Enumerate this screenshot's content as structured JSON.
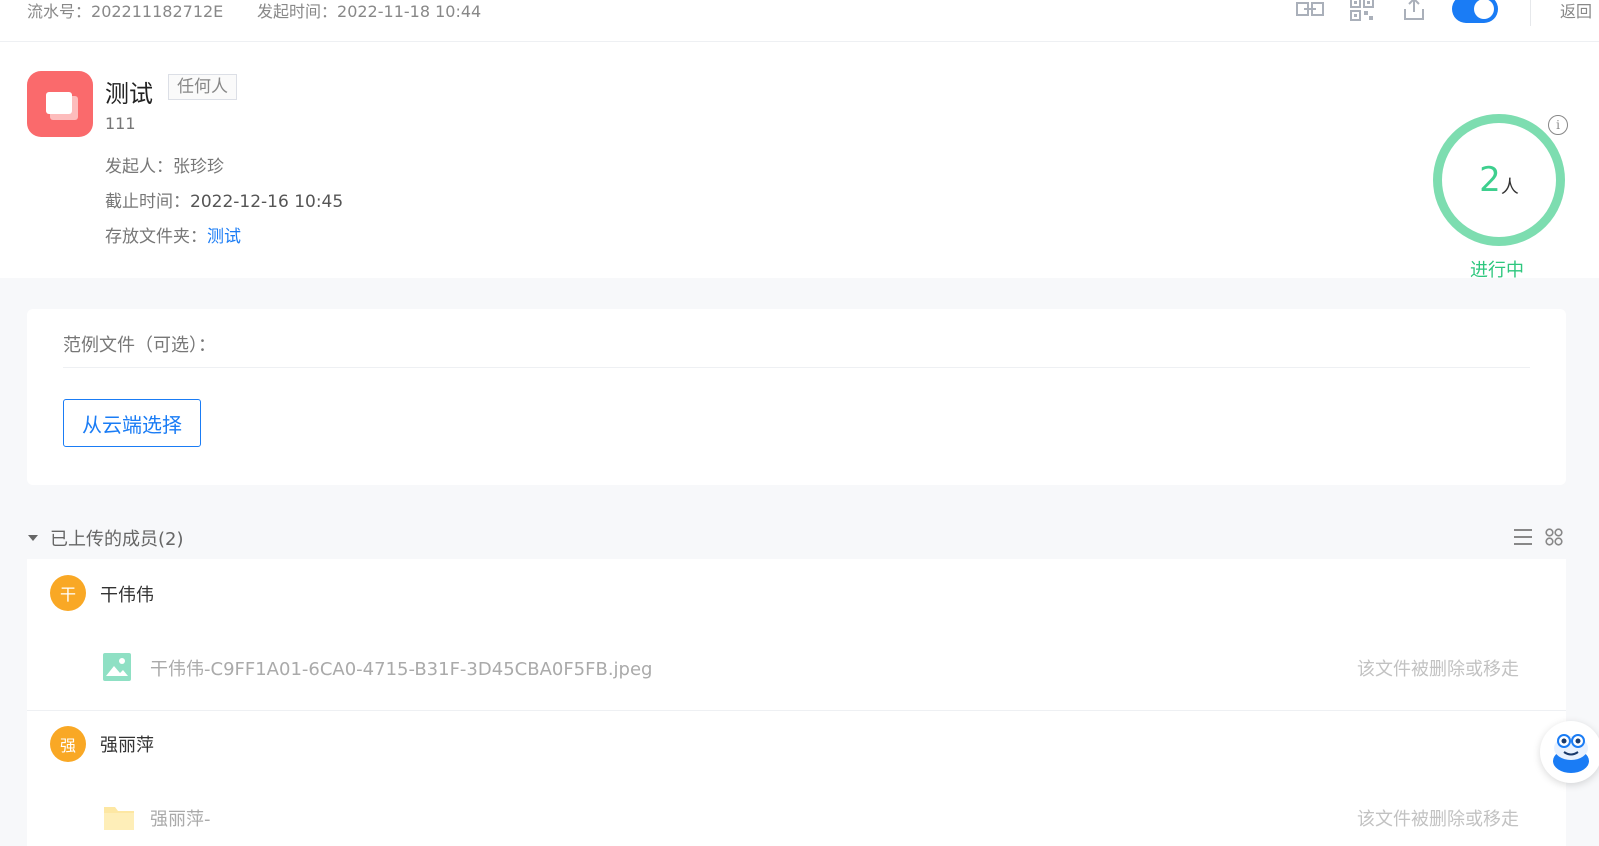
{
  "topbar": {
    "serial_label": "流水号：",
    "serial_value": "202211182712E",
    "start_label": "发起时间：",
    "start_value": "2022-11-18 10:44",
    "back_label": "返回",
    "toggle_on": true
  },
  "task": {
    "title": "测试",
    "tag": "任何人",
    "description": "111",
    "initiator_label": "发起人：",
    "initiator": "张珍珍",
    "deadline_label": "截止时间：",
    "deadline": "2022-12-16 10:45",
    "folder_label": "存放文件夹：",
    "folder": "测试",
    "count": "2",
    "count_unit": "人",
    "status": "进行中"
  },
  "sample": {
    "label": "范例文件（可选）：",
    "button": "从云端选择"
  },
  "uploaded": {
    "title": "已上传的成员(2)",
    "members": [
      {
        "avatar": "干",
        "name": "干伟伟",
        "file_name": "干伟伟-C9FF1A01-6CA0-4715-B31F-3D45CBA0F5FB.jpeg",
        "file_type": "image-file-icon",
        "file_status": "该文件被删除或移走"
      },
      {
        "avatar": "强",
        "name": "强丽萍",
        "file_name": "强丽萍-",
        "file_type": "folder-icon",
        "file_status": "该文件被删除或移走"
      }
    ]
  },
  "colors": {
    "accent": "#1a7cf5",
    "success": "#2ec77e",
    "ring": "#7dddb0",
    "avatar": "#f9a825",
    "app_icon": "#fa6a6c"
  }
}
